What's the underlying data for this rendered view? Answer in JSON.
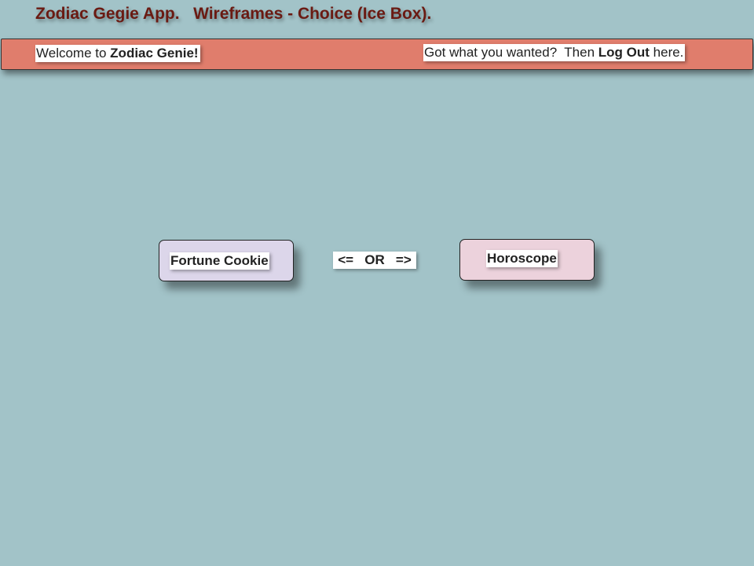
{
  "page": {
    "title": "Zodiac Gegie App.   Wireframes - Choice (Ice Box)."
  },
  "header": {
    "welcome_prefix": "Welcome to ",
    "welcome_app_name": "Zodiac Genie!",
    "logout_prefix": "Got what you wanted?  Then ",
    "logout_link": "Log Out",
    "logout_suffix": " here."
  },
  "choices": {
    "fortune_label": "Fortune Cookie",
    "separator": "<=   OR   =>",
    "horoscope_label": "Horoscope"
  },
  "colors": {
    "background": "#a2c3c8",
    "header_bar": "#e07d6c",
    "title_text": "#6a1a12",
    "fortune_button": "#dcd6ea",
    "horoscope_button": "#ecd2dc"
  }
}
